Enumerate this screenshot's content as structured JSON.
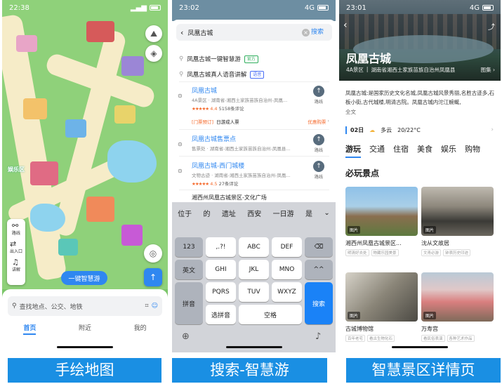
{
  "captions": [
    "手绘地图",
    "搜索-智慧游",
    "智慧景区详情页"
  ],
  "phone1": {
    "time": "22:38",
    "side_buttons": [
      "路线",
      "出入口",
      "讲解"
    ],
    "tour_button": "一键智慧游",
    "search_placeholder": "查找地点、公交、地铁",
    "tabs": [
      "首页",
      "附近",
      "我的"
    ],
    "map_label": "娱乐区"
  },
  "phone2": {
    "time": "23:02",
    "network": "4G",
    "query": "凤凰古城",
    "search_button": "搜索",
    "suggestions": [
      {
        "text": "凤凰古城一键智慧游",
        "tag": "官方",
        "tag_color": "#2fae5d"
      },
      {
        "text": "凤凰古城真人语音讲解",
        "tag": "语音",
        "tag_color": "#4a6ef5"
      }
    ],
    "results": [
      {
        "name": "凤凰古城",
        "sub": "4A景区 · 湖南省-湘西土家族苗族自治州-凤凰...",
        "stars": "★★★★★",
        "score": "4.4",
        "reviews": "5158条评论",
        "route": "路线"
      },
      {
        "name": "凤凰古城售票点",
        "sub": "售票处 · 湖南省-湘西土家族苗族自治州-凤凰县...",
        "route": "路线"
      },
      {
        "name": "凤凰古城-西门城楼",
        "sub": "文物古迹 · 湖南省-湘西土家族苗族自治州-凤凰...",
        "stars": "★★★★★",
        "score": "4.5",
        "reviews": "27条评论",
        "route": "路线"
      },
      {
        "name": "湘西州凤凰古城景区-文化广场",
        "sub": ""
      }
    ],
    "ticket_line": {
      "tag": "[门票预订]",
      "text": "日游成人票",
      "deal": "优惠购票"
    },
    "candidates": [
      "位于",
      "的",
      "遗址",
      "西安",
      "一日游",
      "是"
    ],
    "keys": {
      "row1": [
        "123",
        ",.?!",
        "ABC",
        "DEF",
        "⌫"
      ],
      "row2": [
        "英文",
        "GHI",
        "JKL",
        "MNO",
        "^^"
      ],
      "row3": [
        "拼音",
        "PQRS",
        "TUV",
        "WXYZ",
        "搜索"
      ],
      "row4": [
        "选拼音",
        "空格"
      ]
    }
  },
  "phone3": {
    "time": "23:01",
    "network": "4G",
    "title": "凤凰古城",
    "subtitle_level": "4A景区",
    "subtitle_addr": "湖南省湘西土家族苗族自治州凤凰县",
    "gallery": "图集",
    "description": "凤凰古城:是国家历史文化名城,凤凰古城风景秀丽,名胜古迹多,石板小街,古代城楼,明清古院。凤凰古城内沱江蜿蜒,",
    "desc_more": "全文",
    "weather": {
      "date": "02日",
      "cond": "多云",
      "temp": "20/22°C"
    },
    "categories": [
      "游玩",
      "交通",
      "住宿",
      "美食",
      "娱乐",
      "购物"
    ],
    "section_title": "必玩景点",
    "cards": [
      {
        "label": "图片",
        "name": "湘西州凤凰古城景区...",
        "tags": [
          "明清好去处",
          "物藏乐园美景"
        ]
      },
      {
        "label": "图片",
        "name": "沈从文故居",
        "tags": [
          "文青必游",
          "钟表历史印迹"
        ]
      },
      {
        "label": "图片",
        "name": "古城博物馆",
        "tags": [
          "百年老宅",
          "看古生物化石"
        ]
      },
      {
        "label": "图片",
        "name": "万寿宫",
        "tags": [
          "看民俗表演",
          "各种艺术作品"
        ]
      }
    ]
  }
}
